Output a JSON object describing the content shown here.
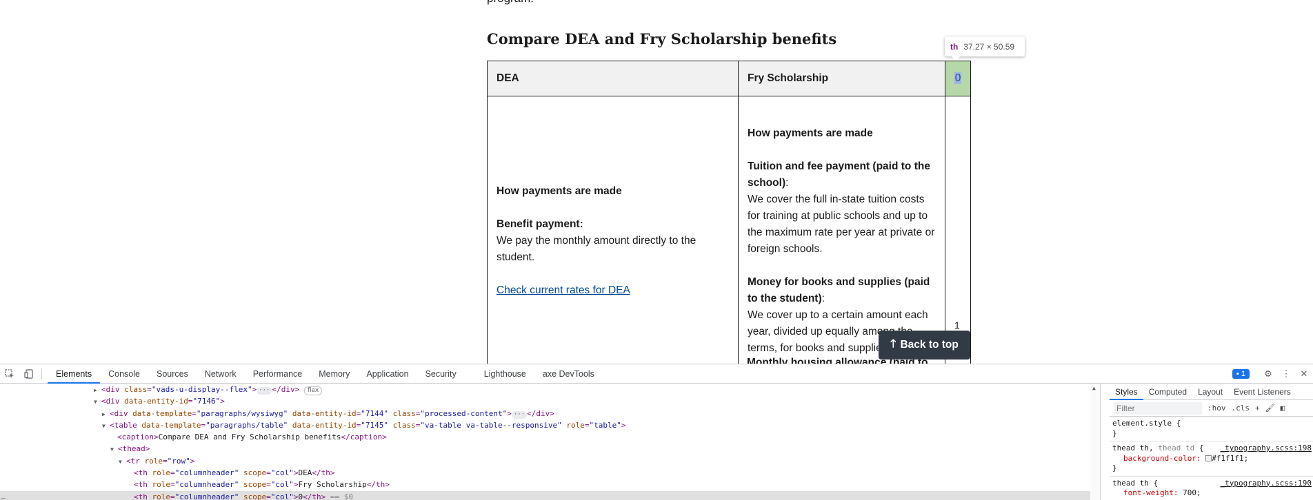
{
  "page": {
    "prev_text": "program.",
    "caption": "Compare DEA and Fry Scholarship benefits",
    "table": {
      "headers": [
        "DEA",
        "Fry Scholarship",
        "0"
      ],
      "dea": {
        "heading": "How payments are made",
        "benefit_label": "Benefit payment:",
        "benefit_text": "We pay the monthly amount directly to the student.",
        "link": "Check current rates for DEA"
      },
      "fry": {
        "heading": "How payments are made",
        "tuition_label": "Tuition and fee payment (paid to the school)",
        "tuition_colon": ":",
        "tuition_text": "We cover the full in-state tuition costs for training at public schools and up to the maximum rate per year at private or foreign schools.",
        "books_label": "Money for books and supplies (paid to the student)",
        "books_colon": ":",
        "books_text": "We cover up to a certain amount each year, divided up equally among the terms, for books and supplies.",
        "housing_label": "Monthly housing allowance (paid to"
      },
      "row_number": "1"
    },
    "back_to_top": "Back to top"
  },
  "tooltip": {
    "tag": "th",
    "dims": "37.27 × 50.59"
  },
  "devtools": {
    "tabs": [
      "Elements",
      "Console",
      "Sources",
      "Network",
      "Performance",
      "Memory",
      "Application",
      "Security",
      "Lighthouse",
      "axe DevTools"
    ],
    "active_tab": "Elements",
    "issues_count": "1",
    "dom": {
      "l1_attr_n": "class",
      "l1_attr_v": "\"vads-u-display--flex\"",
      "l1_pill": "flex",
      "l2_attr_n": "data-entity-id",
      "l2_attr_v": "\"7146\"",
      "l3_a1n": "data-template",
      "l3_a1v": "\"paragraphs/wysiwyg\"",
      "l3_a2n": "data-entity-id",
      "l3_a2v": "\"7144\"",
      "l3_a3n": "class",
      "l3_a3v": "\"processed-content\"",
      "l4_a1n": "data-template",
      "l4_a1v": "\"paragraphs/table\"",
      "l4_a2n": "data-entity-id",
      "l4_a2v": "\"7145\"",
      "l4_a3n": "class",
      "l4_a3v": "\"va-table va-table--responsive\"",
      "l4_a4n": "role",
      "l4_a4v": "\"table\"",
      "caption_text": "Compare DEA and Fry Scholarship benefits",
      "tr_an": "role",
      "tr_av": "\"row\"",
      "th_role_n": "role",
      "th_role_v": "\"columnheader\"",
      "th_scope_n": "scope",
      "th_scope_v": "\"col\"",
      "th1_text": "DEA",
      "th2_text": "Fry Scholarship",
      "th3_text": "0",
      "eq_marker": "== $0"
    },
    "styles": {
      "tabs": [
        "Styles",
        "Computed",
        "Layout",
        "Event Listeners"
      ],
      "active_tab": "Styles",
      "filter_placeholder": "Filter",
      "hov": ":hov",
      "cls": ".cls",
      "rule1_sel": "element.style {",
      "rule2_sel_a": "thead th,",
      "rule2_sel_b": "thead td",
      "rule2_src": "_typography.scss:198",
      "rule2_prop": "background-color:",
      "rule2_val": "#f1f1f1;",
      "rule3_sel": "thead th {",
      "rule3_src": "_typography.scss:190",
      "rule3_prop": "font-weight:",
      "rule3_val": "700;"
    }
  }
}
